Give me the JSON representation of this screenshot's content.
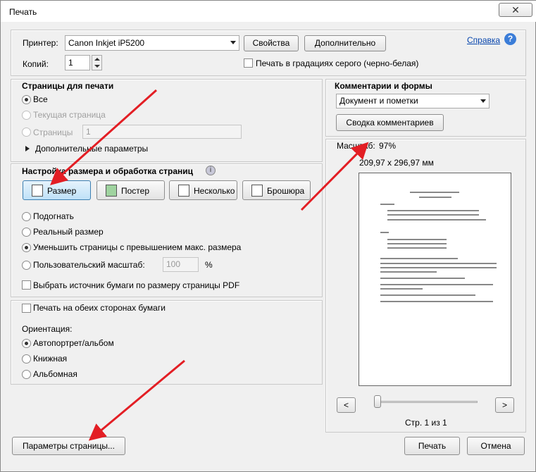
{
  "window": {
    "title": "Печать",
    "close_glyph": "✕"
  },
  "printer": {
    "label": "Принтер:",
    "value": "Canon Inkjet iP5200",
    "properties_btn": "Свойства",
    "advanced_btn": "Дополнительно",
    "help_link": "Справка",
    "copies_label": "Копий:",
    "copies_value": "1",
    "grayscale_label": "Печать в градациях серого (черно-белая)"
  },
  "pages": {
    "title": "Страницы для печати",
    "all": "Все",
    "current": "Текущая страница",
    "pages_label": "Страницы",
    "pages_value": "1",
    "more_options": "Дополнительные параметры"
  },
  "sizing": {
    "title": "Настройка размера и обработка страниц",
    "info_icon": "i",
    "modes": [
      "Размер",
      "Постер",
      "Несколько",
      "Брошюра"
    ],
    "fit": "Подогнать",
    "actual": "Реальный размер",
    "shrink": "Уменьшить страницы с превышением макс. размера",
    "custom": "Пользовательский масштаб:",
    "custom_value": "100",
    "percent": "%",
    "paper_source": "Выбрать источник бумаги по размеру страницы PDF"
  },
  "duplex": {
    "label": "Печать на обеих сторонах бумаги",
    "orientation_label": "Ориентация:",
    "auto": "Автопортрет/альбом",
    "portrait": "Книжная",
    "landscape": "Альбомная"
  },
  "comments": {
    "title": "Комментарии и формы",
    "value": "Документ и пометки",
    "summary_btn": "Сводка комментариев"
  },
  "preview": {
    "scale_label": "Масштаб:",
    "scale_value": "97%",
    "size": "209,97 x 296,97 мм",
    "page_info": "Стр. 1 из 1",
    "prev": "<",
    "next": ">"
  },
  "footer": {
    "page_setup": "Параметры страницы...",
    "print": "Печать",
    "cancel": "Отмена"
  },
  "colors": {
    "accent_red": "#e31e24",
    "link_blue": "#0645ad"
  }
}
